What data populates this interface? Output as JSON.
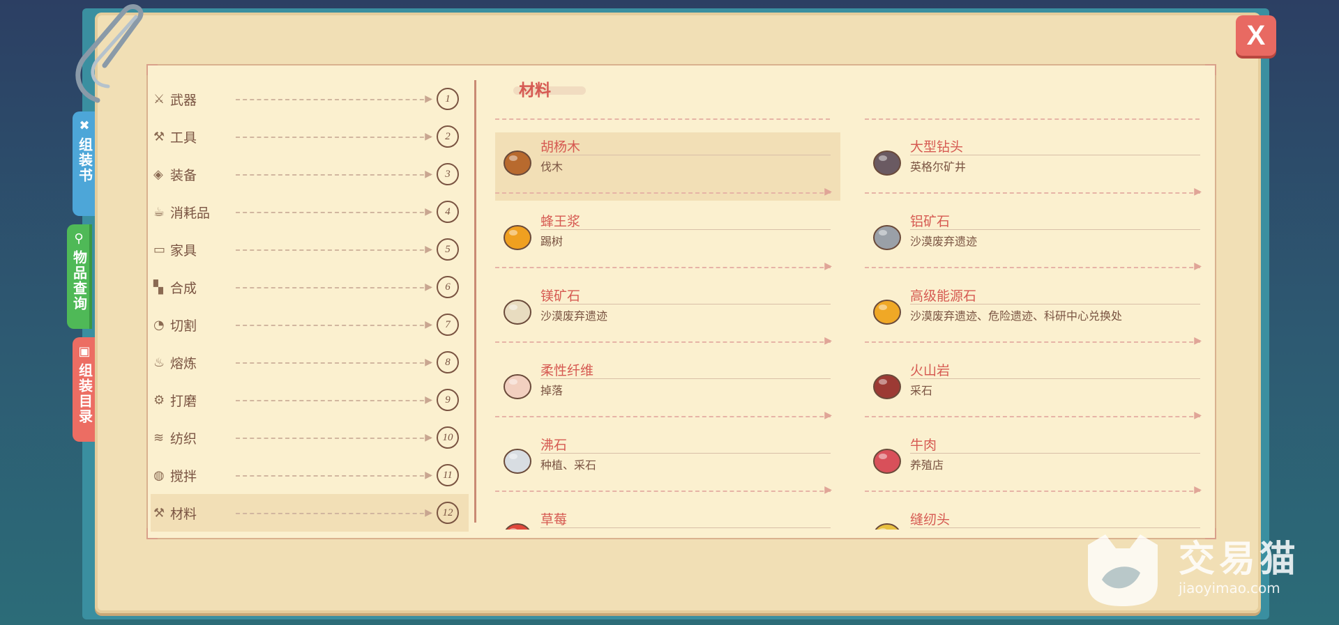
{
  "side_tabs": [
    {
      "label": "组装书",
      "icon": "wrench-icon"
    },
    {
      "label": "物品查询",
      "icon": "search-icon"
    },
    {
      "label": "组装目录",
      "icon": "book-icon"
    }
  ],
  "close_label": "X",
  "categories": [
    {
      "label": "武器",
      "num": "1",
      "icon": "sword-icon"
    },
    {
      "label": "工具",
      "num": "2",
      "icon": "axe-icon"
    },
    {
      "label": "装备",
      "num": "3",
      "icon": "armor-icon"
    },
    {
      "label": "消耗品",
      "num": "4",
      "icon": "food-icon"
    },
    {
      "label": "家具",
      "num": "5",
      "icon": "furniture-icon"
    },
    {
      "label": "合成",
      "num": "6",
      "icon": "blocks-icon"
    },
    {
      "label": "切割",
      "num": "7",
      "icon": "saw-icon"
    },
    {
      "label": "熔炼",
      "num": "8",
      "icon": "fire-icon"
    },
    {
      "label": "打磨",
      "num": "9",
      "icon": "grind-icon"
    },
    {
      "label": "纺织",
      "num": "10",
      "icon": "weave-icon"
    },
    {
      "label": "搅拌",
      "num": "11",
      "icon": "mixer-icon"
    },
    {
      "label": "材料",
      "num": "12",
      "icon": "material-icon"
    }
  ],
  "active_category": "材料",
  "section_title": "材料",
  "items": [
    {
      "name": "胡杨木",
      "source": "伐木",
      "icon": "wood-icon",
      "color": "#b86a2e"
    },
    {
      "name": "大型钻头",
      "source": "英格尔矿井",
      "icon": "drill-icon",
      "color": "#6a5a62"
    },
    {
      "name": "蜂王浆",
      "source": "踢树",
      "icon": "jar-icon",
      "color": "#f0a020"
    },
    {
      "name": "铝矿石",
      "source": "沙漠废弃遗迹",
      "icon": "ore-icon",
      "color": "#9aa0a8"
    },
    {
      "name": "镁矿石",
      "source": "沙漠废弃遗迹",
      "icon": "stone-icon",
      "color": "#e8dcc0"
    },
    {
      "name": "高级能源石",
      "source": "沙漠废弃遗迹、危险遗迹、科研中心兑换处",
      "icon": "crystal-icon",
      "color": "#f0a826"
    },
    {
      "name": "柔性纤维",
      "source": "掉落",
      "icon": "fiber-icon",
      "color": "#f2d0c0"
    },
    {
      "name": "火山岩",
      "source": "采石",
      "icon": "lava-rock-icon",
      "color": "#9c3a34"
    },
    {
      "name": "沸石",
      "source": "种植、采石",
      "icon": "zeolite-icon",
      "color": "#d8dde2"
    },
    {
      "name": "牛肉",
      "source": "养殖店",
      "icon": "beef-icon",
      "color": "#d8505a"
    },
    {
      "name": "草莓",
      "source": "",
      "icon": "strawberry-icon",
      "color": "#e0483a"
    },
    {
      "name": "缝纫头",
      "source": "",
      "icon": "sewing-head-icon",
      "color": "#e8c040"
    }
  ],
  "selected_item": "胡杨木",
  "watermark": {
    "title": "交易猫",
    "url": "jiaoyimao.com"
  }
}
